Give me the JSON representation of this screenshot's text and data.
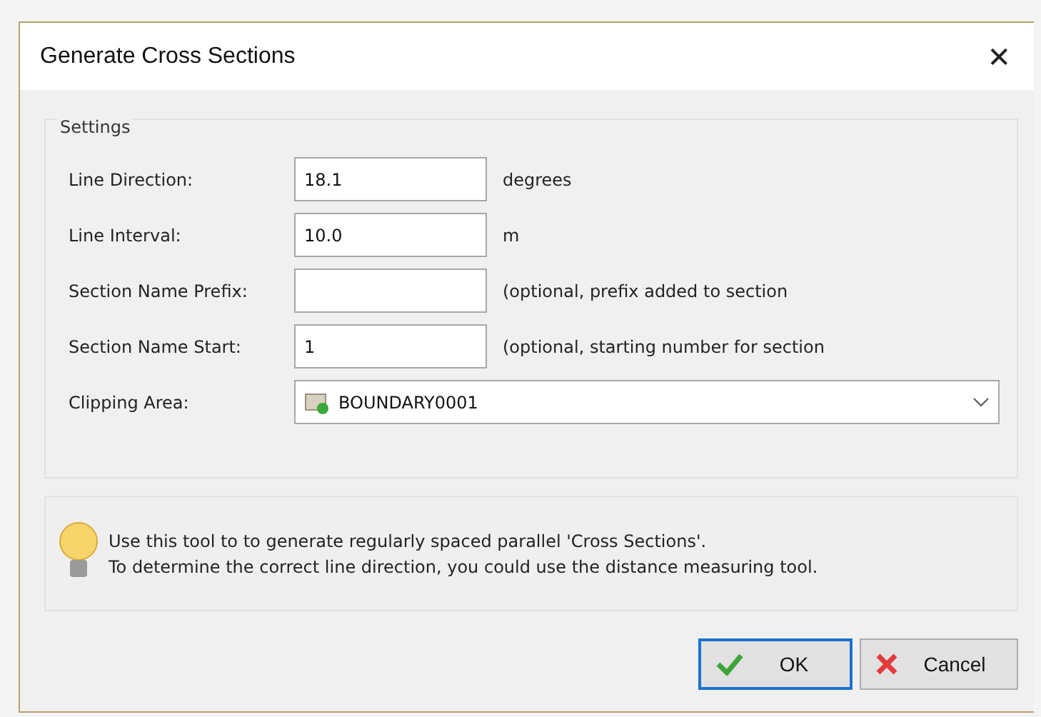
{
  "window": {
    "title": "Generate Cross Sections",
    "close": "✕"
  },
  "settings": {
    "title": "Settings",
    "rows": [
      {
        "kind": "text",
        "label": "Line Direction:",
        "value": "18.1",
        "note": "degrees"
      },
      {
        "kind": "text",
        "label": "Line Interval:",
        "value": "10.0",
        "note": "m"
      },
      {
        "kind": "text",
        "label": "Section Name Prefix:",
        "value": "",
        "note": "(optional, prefix added to section"
      },
      {
        "kind": "text",
        "label": "Section Name Start:",
        "value": "1",
        "note": "(optional, starting number for section"
      },
      {
        "kind": "combo",
        "label": "Clipping Area:",
        "value": "BOUNDARY0001"
      }
    ]
  },
  "info": {
    "lines": [
      "Use this tool to to generate regularly spaced parallel 'Cross Sections'.",
      "To determine the correct line direction, you could use the distance measuring tool."
    ]
  },
  "buttons": [
    {
      "kind": "ok",
      "label": "OK",
      "focused": true
    },
    {
      "kind": "cancel",
      "label": "Cancel",
      "focused": false
    }
  ]
}
